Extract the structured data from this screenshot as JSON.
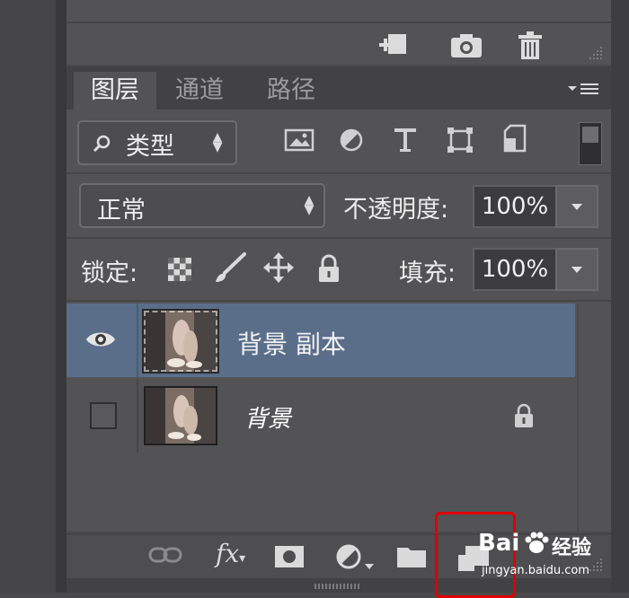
{
  "top_toolbar": {
    "icons": [
      "new-layer-from-icon",
      "camera-icon",
      "trash-icon"
    ]
  },
  "panel": {
    "tabs": [
      {
        "label": "图层",
        "active": true
      },
      {
        "label": "通道",
        "active": false
      },
      {
        "label": "路径",
        "active": false
      }
    ],
    "filter": {
      "label": "类型",
      "icons": [
        "image-filter-icon",
        "adjustment-filter-icon",
        "type-filter-icon",
        "shape-filter-icon",
        "smart-object-filter-icon"
      ]
    },
    "blend_mode": "正常",
    "opacity_label": "不透明度:",
    "opacity_value": "100%",
    "lock_label": "锁定:",
    "fill_label": "填充:",
    "fill_value": "100%",
    "layers": [
      {
        "name": "背景 副本",
        "visible": true,
        "selected": true,
        "locked": false
      },
      {
        "name": "背景",
        "visible": false,
        "selected": false,
        "locked": true
      }
    ]
  },
  "bottom_bar": {
    "fx_label": "fx"
  },
  "watermark": {
    "brand_a": "Bai",
    "brand_b": "经验",
    "url": "jingyan.baidu.com"
  },
  "colors": {
    "selected_layer": "#5a6e8a",
    "annotation": "#e10000"
  }
}
